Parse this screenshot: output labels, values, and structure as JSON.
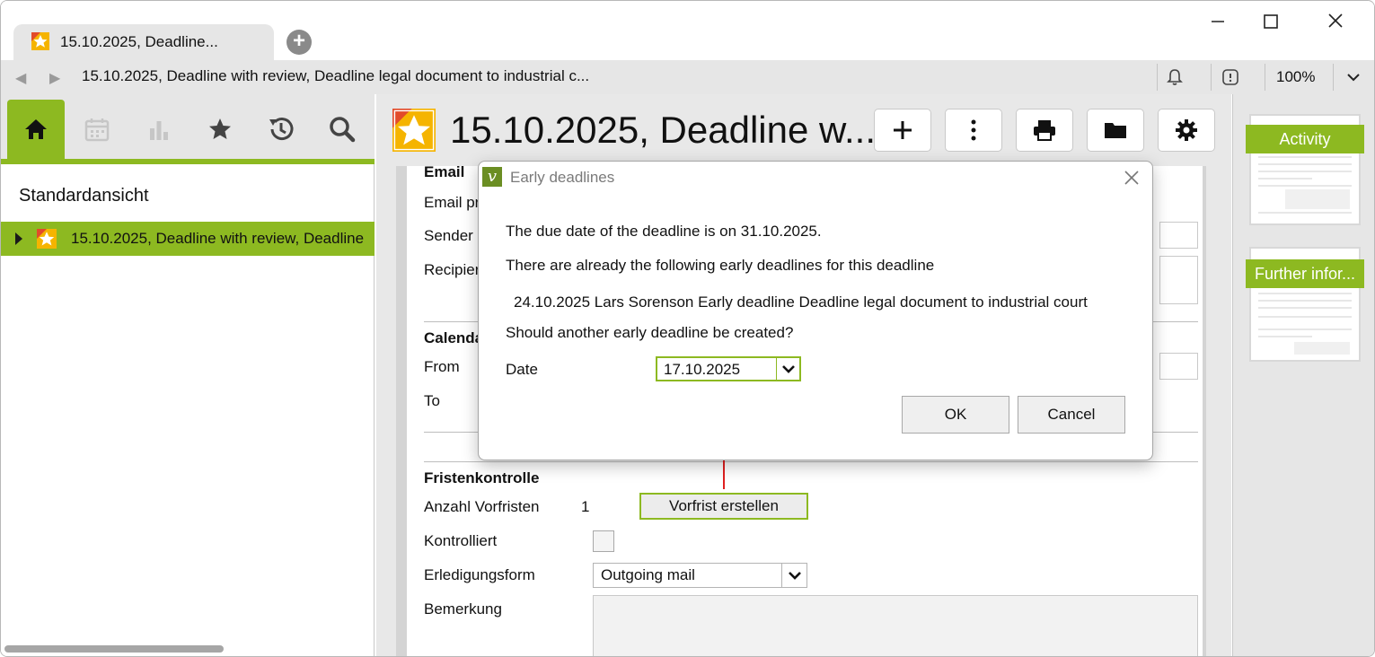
{
  "tab": {
    "title": "15.10.2025, Deadline..."
  },
  "address": {
    "text": "15.10.2025, Deadline with review, Deadline legal document to industrial c...",
    "zoom": "100%"
  },
  "left": {
    "view_title": "Standardansicht",
    "tree_item": "15.10.2025, Deadline with review, Deadline"
  },
  "doc": {
    "title": "15.10.2025, Deadline w..."
  },
  "form": {
    "email_header": "Email",
    "email_priority_label": "Email pr",
    "sender_label": "Sender",
    "recipient_label": "Recipier",
    "calendar_header": "Calenda",
    "from_label": "From",
    "to_label": "To",
    "fristen_header": "Fristenkontrolle",
    "anzahl_label": "Anzahl Vorfristen",
    "anzahl_value": "1",
    "vorfrist_button": "Vorfrist erstellen",
    "kontrolliert_label": "Kontrolliert",
    "erledigung_label": "Erledigungsform",
    "erledigung_value": "Outgoing mail",
    "bemerkung_label": "Bemerkung"
  },
  "right": {
    "activity": "Activity",
    "further": "Further infor..."
  },
  "dialog": {
    "title": "Early deadlines",
    "line1": "The due date of the deadline is on 31.10.2025.",
    "line2": "There are already the following early deadlines for this deadline",
    "entry": "24.10.2025 Lars Sorenson Early deadline Deadline legal document to industrial court",
    "question": "Should another early deadline be created?",
    "date_label": "Date",
    "date_value": "17.10.2025",
    "ok": "OK",
    "cancel": "Cancel"
  },
  "colors": {
    "accent": "#8db921",
    "annotation": "#e02020"
  }
}
